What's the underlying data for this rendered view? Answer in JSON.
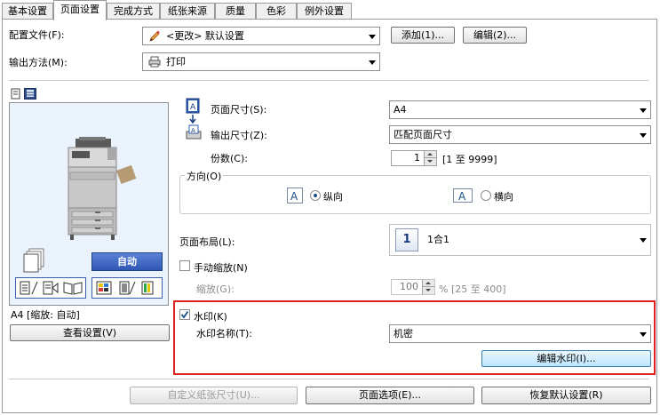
{
  "tabs": [
    "基本设置",
    "页面设置",
    "完成方式",
    "纸张来源",
    "质量",
    "色彩",
    "例外设置"
  ],
  "active_tab": "页面设置",
  "profile": {
    "label": "配置文件(F):",
    "value": "<更改> 默认设置",
    "add_button": "添加(1)...",
    "edit_button": "编辑(2)..."
  },
  "output_method": {
    "label": "输出方法(M):",
    "value": "打印"
  },
  "preview": {
    "auto_button": "自动",
    "status_text": "A4 [缩放: 自动]",
    "view_settings_button": "查看设置(V)"
  },
  "page_size": {
    "label": "页面尺寸(S):",
    "value": "A4"
  },
  "output_size": {
    "label": "输出尺寸(Z):",
    "value": "匹配页面尺寸"
  },
  "copies": {
    "label": "份数(C):",
    "value": "1",
    "range": "[1 至 9999]"
  },
  "orientation": {
    "group_label": "方向(O)",
    "portrait_label": "纵向",
    "landscape_label": "横向",
    "selected": "portrait"
  },
  "layout": {
    "label": "页面布局(L):",
    "value": "1合1",
    "icon_number": "1"
  },
  "manual_scaling": {
    "label": "手动缩放(N)",
    "checked": false,
    "scaling_label": "缩放(G):",
    "scaling_value": "100",
    "scaling_range": "% [25 至 400]"
  },
  "watermark": {
    "label": "水印(K)",
    "checked": true,
    "name_label": "水印名称(T):",
    "name_value": "机密",
    "edit_button": "编辑水印(I)..."
  },
  "bottom_buttons": {
    "custom_paper": "自定义纸张尺寸(U)...",
    "page_options": "页面选项(E)...",
    "restore_defaults": "恢复默认设置(R)"
  },
  "colors": {
    "highlight_red": "#e02020",
    "preview_bg": "#eaf3fb",
    "auto_button_bg": "#3a66c4"
  }
}
